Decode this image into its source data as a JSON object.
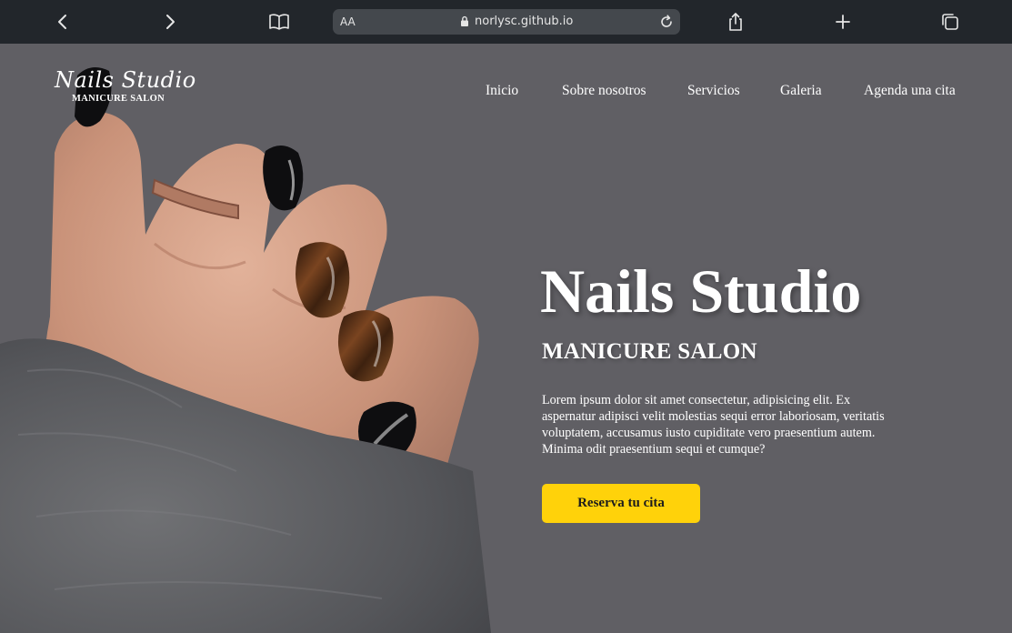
{
  "browser": {
    "url_text_size": "AA",
    "url_host": "norlysc.github.io",
    "icons": [
      "chevron-left-icon",
      "chevron-right-icon",
      "book-icon",
      "lock-icon",
      "reload-icon",
      "share-icon",
      "plus-icon",
      "tabs-icon"
    ]
  },
  "site": {
    "logo_script": "Nails Studio",
    "logo_sub": "MANICURE SALON",
    "nav": [
      {
        "label": "Inicio"
      },
      {
        "label": "Sobre nosotros"
      },
      {
        "label": "Servicios"
      },
      {
        "label": "Galeria"
      },
      {
        "label": "Agenda una cita"
      }
    ],
    "hero": {
      "title": "Nails Studio",
      "subtitle": "MANICURE SALON",
      "text": "Lorem ipsum dolor sit amet consectetur, adipisicing elit. Ex aspernatur adipisci velit molestias sequi error laboriosam, veritatis voluptatem, accusamus iusto cupiditate vero praesentium autem. Minima odit praesentium sequi et cumque?",
      "cta_label": "Reserva tu cita"
    },
    "colors": {
      "toolbar": "#22262b",
      "background": "#605f64",
      "accent": "#ffd20a",
      "sweater": "#5a5b5e",
      "skin": "#d7a48c",
      "nail_black": "#0e0e10",
      "nail_tortoise": "#5a2f14"
    }
  }
}
